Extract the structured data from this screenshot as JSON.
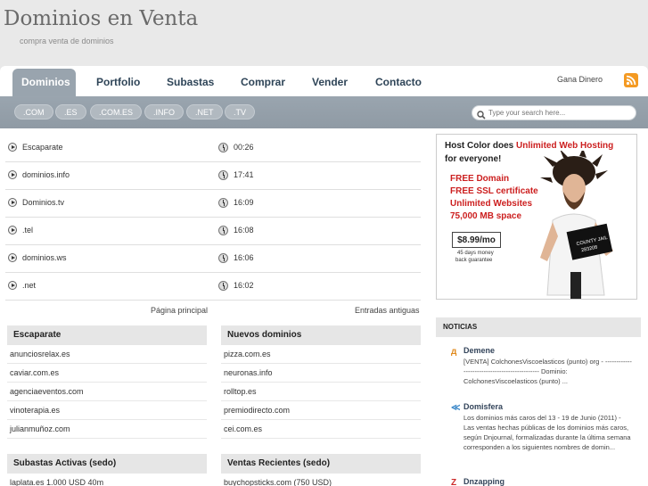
{
  "site": {
    "title": "Dominios en Venta",
    "subtitle": "compra venta de dominios"
  },
  "nav": {
    "items": [
      "Dominios",
      "Portfolio",
      "Subastas",
      "Comprar",
      "Vender",
      "Contacto"
    ],
    "right_link": "Gana Dinero"
  },
  "tlds": [
    ".COM",
    ".ES",
    ".COM.ES",
    ".INFO",
    ".NET",
    ".TV"
  ],
  "search": {
    "placeholder": "Type your search here..."
  },
  "posts": [
    {
      "title": "Escaparate",
      "time": "00:26"
    },
    {
      "title": "dominios.info",
      "time": "17:41"
    },
    {
      "title": "Dominios.tv",
      "time": "16:09"
    },
    {
      "title": ".tel",
      "time": "16:08"
    },
    {
      "title": "dominios.ws",
      "time": "16:06"
    },
    {
      "title": ".net",
      "time": "16:02"
    }
  ],
  "pager": {
    "prev": "Página principal",
    "next": "Entradas antiguas"
  },
  "boxes": {
    "escaparate": {
      "title": "Escaparate",
      "items": [
        "anunciosrelax.es",
        "caviar.com.es",
        "agenciaeventos.com",
        "vinoterapia.es",
        "julianmuñoz.com"
      ]
    },
    "nuevos": {
      "title": "Nuevos dominios",
      "items": [
        "pizza.com.es",
        "neuronas.info",
        "rolltop.es",
        "premiodirecto.com",
        "cei.com.es"
      ]
    },
    "subastas": {
      "title": "Subastas Activas (sedo)",
      "items": [
        "laplata.es 1.000 USD 40m"
      ]
    },
    "ventas": {
      "title": "Ventas Recientes (sedo)",
      "items": [
        "buychopsticks.com (750 USD)"
      ]
    }
  },
  "ad": {
    "line1a": "Host Color does ",
    "line1b": "Unlimited Web Hosting",
    "line2": "for everyone!",
    "features": [
      "FREE Domain",
      "FREE SSL certificate",
      "Unlimited Websites",
      "75,000 MB space"
    ],
    "price": "$8.99/mo",
    "guarantee1": "45 days money",
    "guarantee2": "back guarantee",
    "sign1": "COUNTY JAIL",
    "sign2": "283208"
  },
  "news": {
    "header": "NOTICIAS",
    "items": [
      {
        "title": "Demene",
        "body": "[VENTA] ColchonesViscoelasticos (punto) org - ---------------------------------------------- Dominio: ColchonesViscoelasticos (punto) ...",
        "icon": "demene-icon",
        "color": "#e08a1e"
      },
      {
        "title": "Domisfera",
        "body": "Los dominios más caros del 13 - 19 de Junio (2011) - Las ventas hechas públicas de los dominios más caros, según Dnjournal, formalizadas durante la última semana corresponden a los siguientes nombres de domin...",
        "icon": "domisfera-icon",
        "color": "#3a87c8"
      },
      {
        "title": "Dnzapping",
        "body": "",
        "icon": "dnzapping-icon",
        "color": "#cc2a2a"
      }
    ]
  },
  "colors": {
    "nav_active": "#99a4ae",
    "sub_bar": "#99a4ae",
    "ad_red": "#cc1f1f",
    "rss": "#f49a22"
  }
}
